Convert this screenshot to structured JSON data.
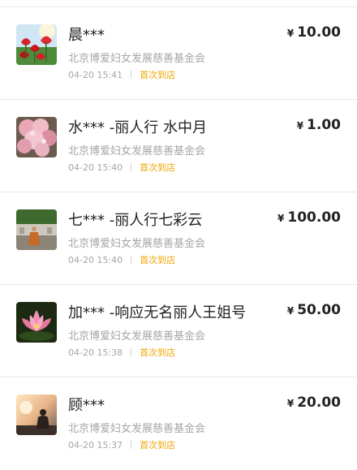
{
  "donations": [
    {
      "avatar_icon": "tulip-photo-icon",
      "donor": "晨***",
      "org": "北京博爱妇女发展慈善基金会",
      "time": "04-20 15:41",
      "badge": "首次到店",
      "currency": "¥",
      "amount": "10.00"
    },
    {
      "avatar_icon": "pink-blossom-photo-icon",
      "donor": "水*** -丽人行 水中月",
      "org": "北京博爱妇女发展慈善基金会",
      "time": "04-20 15:40",
      "badge": "首次到店",
      "currency": "¥",
      "amount": "1.00"
    },
    {
      "avatar_icon": "monk-photo-icon",
      "donor": "七*** -丽人行七彩云",
      "org": "北京博爱妇女发展慈善基金会",
      "time": "04-20 15:40",
      "badge": "首次到店",
      "currency": "¥",
      "amount": "100.00"
    },
    {
      "avatar_icon": "lotus-photo-icon",
      "donor": "加*** -响应无名丽人王姐号",
      "org": "北京博爱妇女发展慈善基金会",
      "time": "04-20 15:38",
      "badge": "首次到店",
      "currency": "¥",
      "amount": "50.00"
    },
    {
      "avatar_icon": "sunset-silhouette-photo-icon",
      "donor": "顾***",
      "org": "北京博爱妇女发展慈善基金会",
      "time": "04-20 15:37",
      "badge": "首次到店",
      "currency": "¥",
      "amount": "20.00"
    }
  ]
}
